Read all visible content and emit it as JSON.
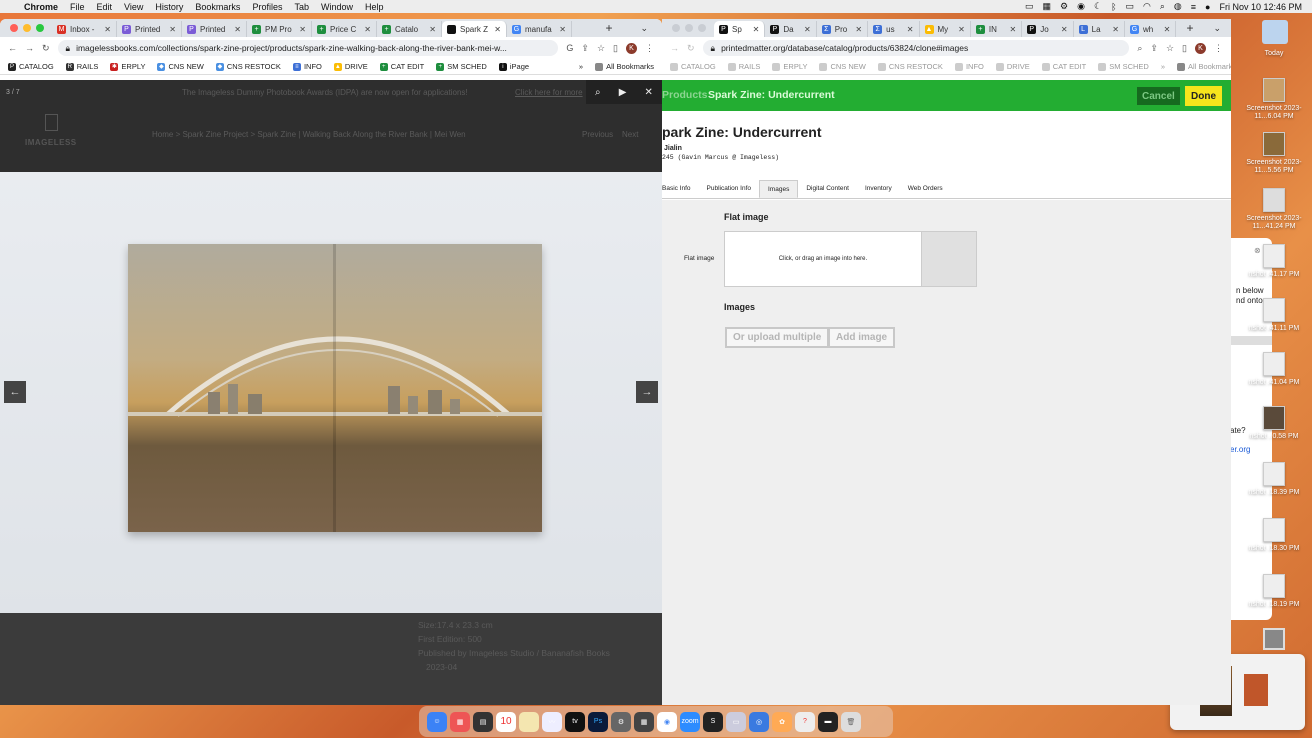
{
  "menubar": {
    "items": [
      "Chrome",
      "File",
      "Edit",
      "View",
      "History",
      "Bookmarks",
      "Profiles",
      "Tab",
      "Window",
      "Help"
    ],
    "datetime": "Fri Nov 10  12:46 PM"
  },
  "left_window": {
    "tabs": [
      {
        "label": "Inbox -",
        "fav": "#d93025",
        "glyph": "M"
      },
      {
        "label": "Printed",
        "fav": "#7b5cd6",
        "glyph": "P"
      },
      {
        "label": "Printed",
        "fav": "#7b5cd6",
        "glyph": "P"
      },
      {
        "label": "PM Pro",
        "fav": "#1e8e3e",
        "glyph": "+"
      },
      {
        "label": "Price C",
        "fav": "#1e8e3e",
        "glyph": "+"
      },
      {
        "label": "Catalo",
        "fav": "#1e8e3e",
        "glyph": "+"
      },
      {
        "label": "Spark Z",
        "fav": "#111111",
        "glyph": ""
      },
      {
        "label": "manufa",
        "fav": "#4285f4",
        "glyph": "G"
      }
    ],
    "url": "imagelessbooks.com/collections/spark-zine-project/products/spark-zine-walking-back-along-the-river-bank-mei-w...",
    "bookmarks": [
      {
        "label": "CATALOG",
        "color": "#222",
        "glyph": "P"
      },
      {
        "label": "RAILS",
        "color": "#333",
        "glyph": "R"
      },
      {
        "label": "ERPLY",
        "color": "#c82020",
        "glyph": "✱"
      },
      {
        "label": "CNS NEW",
        "color": "#4a90e2",
        "glyph": "◆"
      },
      {
        "label": "CNS RESTOCK",
        "color": "#4a90e2",
        "glyph": "◆"
      },
      {
        "label": "INFO",
        "color": "#3d6fd6",
        "glyph": "≡"
      },
      {
        "label": "DRIVE",
        "color": "#fbbc04",
        "glyph": "▲"
      },
      {
        "label": "CAT EDIT",
        "color": "#1e8e3e",
        "glyph": "+"
      },
      {
        "label": "SM SCHED",
        "color": "#1e8e3e",
        "glyph": "+"
      },
      {
        "label": "iPage",
        "color": "#111",
        "glyph": "i"
      }
    ],
    "all_bookmarks": "All Bookmarks",
    "lightbox_counter": "3 / 7",
    "announcement": "The Imageless Dummy Photobook Awards (IDPA) are now open for applications!",
    "announcement_link": "Click here for more",
    "logo_text": "IMAGELESS",
    "breadcrumb": "Home  >  Spark Zine Project  >  Spark Zine | Walking Back Along the River Bank | Mei Wen",
    "nav_prev": "Previous",
    "nav_next": "Next",
    "details": [
      "Size:17.4 x 23.3 cm",
      "First Edition: 500",
      "Published by Imageless Studio / Bananafish Books",
      "2023-04"
    ]
  },
  "right_window": {
    "tabs": [
      {
        "label": "Sp",
        "fav": "#111",
        "glyph": "P"
      },
      {
        "label": "Da",
        "fav": "#111",
        "glyph": "P"
      },
      {
        "label": "Pro",
        "fav": "#3d6fd6",
        "glyph": "Σ"
      },
      {
        "label": "us",
        "fav": "#3d6fd6",
        "glyph": "Σ"
      },
      {
        "label": "My",
        "fav": "#fbbc04",
        "glyph": "▲"
      },
      {
        "label": "IN",
        "fav": "#1e8e3e",
        "glyph": "+"
      },
      {
        "label": "Jo",
        "fav": "#111",
        "glyph": "P"
      },
      {
        "label": "La",
        "fav": "#3d6fd6",
        "glyph": "L"
      },
      {
        "label": "wh",
        "fav": "#4285f4",
        "glyph": "G"
      }
    ],
    "url": "printedmatter.org/database/catalog/products/63824/clone#images",
    "bookmarks": [
      "CATALOG",
      "RAILS",
      "ERPLY",
      "CNS NEW",
      "CNS RESTOCK",
      "INFO",
      "DRIVE",
      "CAT EDIT",
      "SM SCHED"
    ],
    "all_bookmarks": "All Bookmarks",
    "header_crumb": "Products",
    "header_title": "Spark Zine: Undercurrent",
    "cancel": "Cancel",
    "done": "Done",
    "product_title": "park Zine: Undercurrent",
    "author": "Jialin",
    "meta": "245 (Gavin Marcus @ Imageless)",
    "form_tabs": [
      "Basic Info",
      "Publication Info",
      "Images",
      "Digital Content",
      "Inventory",
      "Web Orders"
    ],
    "active_tab": "Images",
    "flat_image_heading": "Flat image",
    "flat_image_label": "Flat image",
    "dropzone_text": "Click, or drag an image into here.",
    "images_heading": "Images",
    "upload_multiple": "Or upload multiple",
    "add_image": "Add image"
  },
  "desktop": {
    "icons": [
      {
        "label": "Today"
      },
      {
        "label": "Screenshot 2023-11...6.04 PM"
      },
      {
        "label": "Screenshot 2023-11...5.56 PM"
      },
      {
        "label": "Screenshot 2023-11...41.24 PM"
      },
      {
        "label": "nshot .41.17 PM"
      },
      {
        "label": "nshot .41.11 PM"
      },
      {
        "label": "nshot .41.04 PM"
      },
      {
        "label": "nshot ..0.58 PM"
      },
      {
        "label": "nshot .18.39 PM"
      },
      {
        "label": "nshot .18.30 PM"
      },
      {
        "label": "nshot .18.19 PM"
      }
    ],
    "bg_window_text": [
      "n below",
      "nd onto",
      "ate?",
      "er.org"
    ]
  },
  "dock": {
    "date": "10"
  }
}
